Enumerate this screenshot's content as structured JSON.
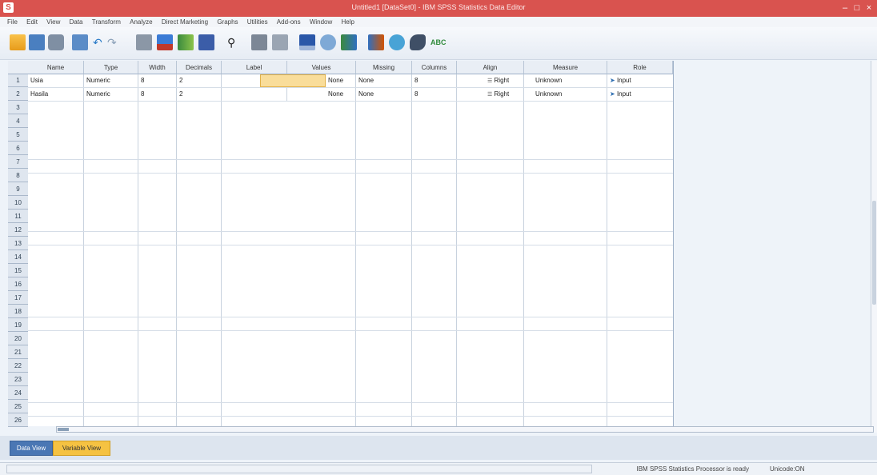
{
  "window": {
    "title": "Untitled1 [DataSet0] - IBM SPSS Statistics Data Editor",
    "minimize": "–",
    "maximize": "□",
    "close": "×"
  },
  "menu": [
    "File",
    "Edit",
    "View",
    "Data",
    "Transform",
    "Analyze",
    "Direct Marketing",
    "Graphs",
    "Utilities",
    "Add-ons",
    "Window",
    "Help"
  ],
  "toolbar": {
    "icons": [
      "open-folder",
      "save",
      "print",
      "dialog-recall",
      "undo",
      "redo",
      "goto-case",
      "goto-variable",
      "variables",
      "run-descriptives",
      "find",
      "insert-cases",
      "insert-variable",
      "split-file",
      "weight-cases",
      "select-cases",
      "value-labels",
      "use-variable-sets",
      "show-all-variables",
      "spelling"
    ],
    "spell_label": "ABC"
  },
  "columns": [
    "Name",
    "Type",
    "Width",
    "Decimals",
    "Label",
    "Values",
    "Missing",
    "Columns",
    "Align",
    "Measure",
    "Role"
  ],
  "rows": [
    {
      "name": "Usia",
      "type": "Numeric",
      "width": "8",
      "decimals": "2",
      "label": "",
      "values": "None",
      "missing": "None",
      "columns": "8",
      "align": "Right",
      "measure": "Unknown",
      "role": "Input"
    },
    {
      "name": "Hasila",
      "type": "Numeric",
      "width": "8",
      "decimals": "2",
      "label": "",
      "values": "None",
      "missing": "None",
      "columns": "8",
      "align": "Right",
      "measure": "Unknown",
      "role": "Input"
    }
  ],
  "row_numbers": [
    "1",
    "2",
    "3",
    "4",
    "5",
    "6",
    "7",
    "8",
    "9",
    "10",
    "11",
    "12",
    "13",
    "14",
    "15",
    "16",
    "17",
    "18",
    "19",
    "20",
    "21",
    "22",
    "23",
    "24",
    "25",
    "26"
  ],
  "tabs": {
    "data_view": "Data View",
    "variable_view": "Variable View"
  },
  "status": {
    "processor": "IBM SPSS Statistics Processor is ready",
    "encoding": "Unicode:ON"
  },
  "colors": {
    "titlebar": "#d9534f",
    "active_tab": "#f5c242",
    "selected_cell": "#f9dd9a"
  }
}
